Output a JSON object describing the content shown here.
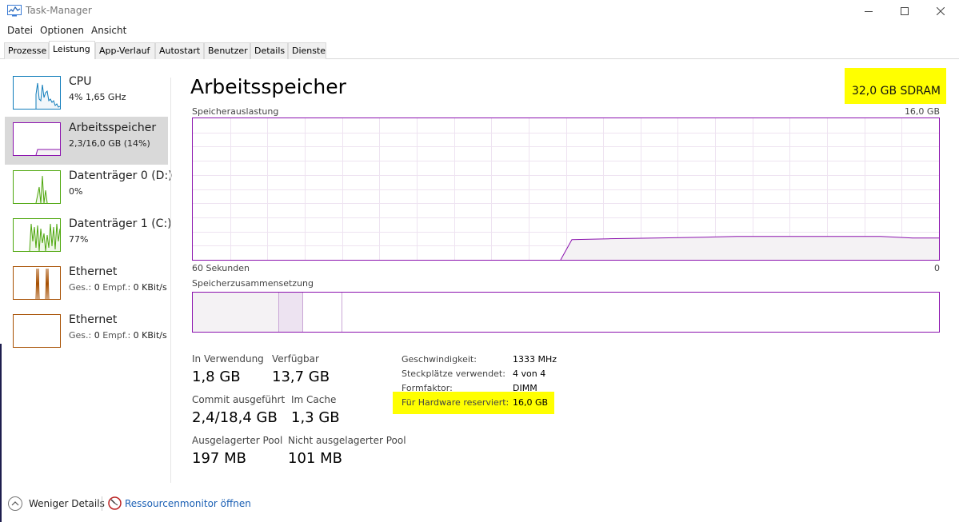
{
  "window": {
    "title": "Task-Manager",
    "icon": "task-manager-icon",
    "controls": [
      "minimize-icon",
      "maximize-icon",
      "close-icon"
    ]
  },
  "menu": {
    "items": [
      "Datei",
      "Optionen",
      "Ansicht"
    ]
  },
  "tabs": [
    {
      "label": "Prozesse",
      "active": false
    },
    {
      "label": "Leistung",
      "active": true
    },
    {
      "label": "App-Verlauf",
      "active": false
    },
    {
      "label": "Autostart",
      "active": false
    },
    {
      "label": "Benutzer",
      "active": false
    },
    {
      "label": "Details",
      "active": false
    },
    {
      "label": "Dienste",
      "active": false
    }
  ],
  "sidebar": {
    "items": [
      {
        "title": "CPU",
        "sub": "4%  1,65 GHz",
        "color": "#117dbb",
        "selected": false
      },
      {
        "title": "Arbeitsspeicher",
        "sub": "2,3/16,0 GB (14%)",
        "color": "#8b12ae",
        "selected": true
      },
      {
        "title": "Datenträger 0 (D:)",
        "sub": "0%",
        "color": "#4da60c",
        "selected": false
      },
      {
        "title": "Datenträger 1 (C:)",
        "sub": "77%",
        "color": "#4da60c",
        "selected": false
      },
      {
        "title": "Ethernet",
        "sub_label1": "Ges.:",
        "sub_value1": "0",
        "sub_label2": "Empf.:",
        "sub_value2": "0 KBit/s",
        "color": "#a74f01",
        "selected": false
      },
      {
        "title": "Ethernet",
        "sub_label1": "Ges.:",
        "sub_value1": "0",
        "sub_label2": "Empf.:",
        "sub_value2": "0 KBit/s",
        "color": "#a74f01",
        "selected": false
      }
    ]
  },
  "main": {
    "title": "Arbeitsspeicher",
    "hardware": "32,0 GB SDRAM",
    "usage_graph": {
      "label": "Speicherauslastung",
      "max_label": "16,0 GB",
      "time_label": "60 Sekunden",
      "zero_label": "0",
      "color": "#8b12ae",
      "fill_color": "#f4f2f4",
      "level_fraction": 0.16
    },
    "composition": {
      "label": "Speicherzusammensetzung",
      "segments": [
        {
          "name": "in-use",
          "fraction": 0.116,
          "color": "#f4f2f4"
        },
        {
          "name": "modified",
          "fraction": 0.032,
          "color": "#ede3f1"
        },
        {
          "name": "standby",
          "fraction": 0.052,
          "color": "#ffffff"
        },
        {
          "name": "free",
          "fraction": 0.8,
          "color": "#ffffff"
        }
      ]
    },
    "stats": {
      "in_use_label": "In Verwendung",
      "in_use_value": "1,8 GB",
      "available_label": "Verfügbar",
      "available_value": "13,7 GB",
      "commit_label": "Commit ausgeführt",
      "commit_value": "2,4/18,4 GB",
      "cache_label": "Im Cache",
      "cache_value": "1,3 GB",
      "paged_label": "Ausgelagerter Pool",
      "paged_value": "197 MB",
      "nonpaged_label": "Nicht ausgelagerter Pool",
      "nonpaged_value": "101 MB"
    },
    "info": {
      "speed_label": "Geschwindigkeit:",
      "speed_value": "1333 MHz",
      "slots_label": "Steckplätze verwendet:",
      "slots_value": "4 von 4",
      "form_label": "Formfaktor:",
      "form_value": "DIMM",
      "reserved_label": "Für Hardware reserviert:",
      "reserved_value": "16,0 GB"
    }
  },
  "footer": {
    "fewer_details": "Weniger Details",
    "resource_monitor": "Ressourcenmonitor öffnen"
  },
  "highlight_color": "#ffff00"
}
